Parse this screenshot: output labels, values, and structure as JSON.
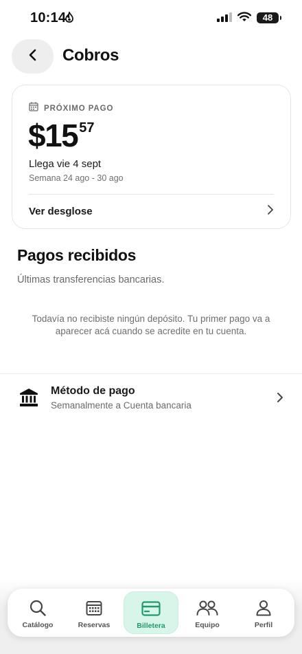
{
  "status_bar": {
    "time": "10:14",
    "battery": "48"
  },
  "header": {
    "title": "Cobros"
  },
  "next_payment": {
    "label": "PRÓXIMO PAGO",
    "amount_main": "$15",
    "amount_cents": "57",
    "arrival": "Llega vie 4 sept",
    "week": "Semana 24 ago - 30 ago",
    "breakdown_label": "Ver desglose"
  },
  "received": {
    "title": "Pagos recibidos",
    "subtitle": "Últimas transferencias bancarias.",
    "empty_message": "Todavía no recibiste ningún depósito. Tu primer pago va a aparecer acá cuando se acredite en tu cuenta."
  },
  "payment_method": {
    "title": "Método de pago",
    "subtitle": "Semanalmente a Cuenta bancaria"
  },
  "nav": {
    "items": [
      {
        "label": "Catálogo",
        "icon": "search-icon"
      },
      {
        "label": "Reservas",
        "icon": "calendar-icon"
      },
      {
        "label": "Billetera",
        "icon": "card-icon",
        "active": true
      },
      {
        "label": "Equipo",
        "icon": "team-icon"
      },
      {
        "label": "Perfil",
        "icon": "person-icon"
      }
    ]
  },
  "colors": {
    "accent": "#1f9a6f",
    "active_tab_bg": "#d8f5ea"
  }
}
